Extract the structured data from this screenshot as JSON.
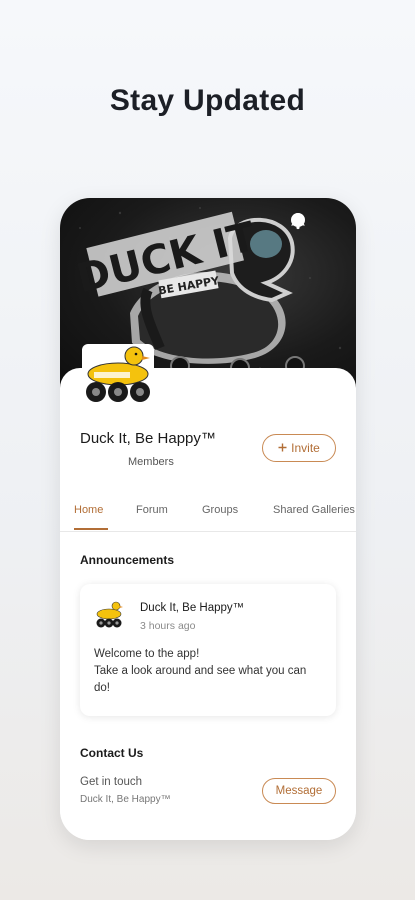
{
  "headline": "Stay Updated",
  "cover": {
    "art_text_main": "DUCK IT",
    "art_text_sub": "BE HAPPY",
    "more_icon": "more-horizontal-icon",
    "bell_icon": "bell-icon"
  },
  "group": {
    "name": "Duck It, Be Happy™",
    "members_label": "Members",
    "invite_label": "Invite",
    "invite_icon": "plus-icon"
  },
  "tabs": [
    {
      "label": "Home",
      "active": true
    },
    {
      "label": "Forum",
      "active": false
    },
    {
      "label": "Groups",
      "active": false
    },
    {
      "label": "Shared Galleries",
      "active": false
    }
  ],
  "announcements": {
    "title": "Announcements",
    "post": {
      "author": "Duck It, Be Happy™",
      "time": "3 hours ago",
      "line1": "Welcome to the app!",
      "line2": "Take a look around and see what you can do!"
    }
  },
  "contact": {
    "title": "Contact Us",
    "line1": "Get in touch",
    "line2": "Duck It, Be Happy™",
    "message_label": "Message"
  },
  "colors": {
    "accent": "#b26e36",
    "duck_yellow": "#f4c20d"
  }
}
